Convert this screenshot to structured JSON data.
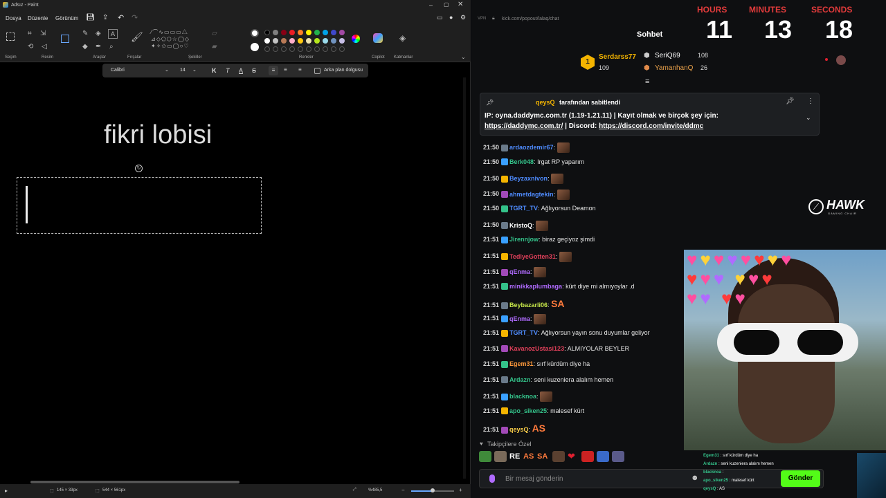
{
  "paint": {
    "title": "Adsız - Paint",
    "menu": [
      "Dosya",
      "Düzenle",
      "Görünüm"
    ],
    "groups": {
      "selection": "Seçim",
      "image": "Resim",
      "tools": "Araçlar",
      "brushes": "Fırçalar",
      "shapes": "Şekiller",
      "colors": "Renkler",
      "copilot": "Copilot",
      "layers": "Katmanlar"
    },
    "text_toolbar": {
      "font": "Calibri",
      "size": "14",
      "bold": "K",
      "italic": "T",
      "fill_label": "Arka plan dolgusu"
    },
    "canvas_text": "fikri lobisi",
    "status": {
      "selection_size": "145 × 33px",
      "canvas_size": "544 × 561px",
      "zoom": "%485,5"
    },
    "colors": [
      "#000000",
      "#7f7f7f",
      "#880015",
      "#ed1c24",
      "#ff7f27",
      "#fff200",
      "#22b14c",
      "#00a2e8",
      "#3f48cc",
      "#a349a4",
      "#ffffff",
      "#c3c3c3",
      "#b97a57",
      "#ffaec9",
      "#ffc90e",
      "#efe4b0",
      "#b5e61d",
      "#99d9ea",
      "#7092be",
      "#c8bfe7"
    ]
  },
  "browser": {
    "url": "kick.com/popout/lalaq/chat"
  },
  "chat": {
    "header": "Sohbet",
    "leaders": [
      {
        "rank": "1",
        "name": "Serdarss77",
        "count": "109"
      },
      {
        "name": "SeriQ69",
        "count": "108"
      },
      {
        "name": "YamanhanQ",
        "count": "26"
      }
    ],
    "pinned": {
      "user": "qeysQ",
      "suffix": "tarafından sabitlendi",
      "line1": "IP: oyna.daddymc.com.tr (1.19-1.21.11) | Kayıt olmak ve birçok şey için:",
      "link1": "https://daddymc.com.tr/",
      "sep": " | Discord: ",
      "link2": "https://discord.com/invite/ddmc"
    },
    "messages": [
      {
        "time": "21:50",
        "user": "ardaozdemir67",
        "color": "#4f8cff",
        "text": ""
      },
      {
        "time": "21:50",
        "user": "Berk048",
        "color": "#34c28a",
        "text": "Irgat RP yaparım"
      },
      {
        "time": "21:50",
        "user": "Beyzaxnivon",
        "color": "#4f8cff",
        "text": ""
      },
      {
        "time": "21:50",
        "user": "ahmetdagtekin",
        "color": "#4f8cff",
        "text": ""
      },
      {
        "time": "21:50",
        "user": "TGRT_TV",
        "color": "#4f8cff",
        "text": "Ağlıyorsun Deamon"
      },
      {
        "time": "21:50",
        "user": "KristoQ",
        "color": "#ffffff",
        "text": ""
      },
      {
        "time": "21:51",
        "user": "Jirennjow",
        "color": "#34c28a",
        "text": "biraz geçiyoz şimdi"
      },
      {
        "time": "21:51",
        "user": "TedlyeGotten31",
        "color": "#e0405a",
        "text": ""
      },
      {
        "time": "21:51",
        "user": "qEnma",
        "color": "#b06bff",
        "text": ""
      },
      {
        "time": "21:51",
        "user": "minikkaplumbaga",
        "color": "#b06bff",
        "text": "kürt diye mi almıyoylar .d"
      },
      {
        "time": "21:51",
        "user": "Beybazarli06",
        "color": "#c8e84a",
        "text": "SA"
      },
      {
        "time": "21:51",
        "user": "qEnma",
        "color": "#b06bff",
        "text": ""
      },
      {
        "time": "21:51",
        "user": "TGRT_TV",
        "color": "#4f8cff",
        "text": "Ağlıyorsun yayın sonu duyumlar geliyor"
      },
      {
        "time": "21:51",
        "user": "KavanozUstasi123",
        "color": "#e0405a",
        "text": "ALMIYOLAR BEYLER"
      },
      {
        "time": "21:51",
        "user": "Egem31",
        "color": "#ff9a3c",
        "text": "sırf kürdüm diye ha"
      },
      {
        "time": "21:51",
        "user": "Ardazn",
        "color": "#34c28a",
        "text": "seni kuzeniera alalım hemen"
      },
      {
        "time": "21:51",
        "user": "blacknoa",
        "color": "#34c28a",
        "text": ""
      },
      {
        "time": "21:51",
        "user": "apo_siken25",
        "color": "#34c28a",
        "text": "malesef kürt"
      },
      {
        "time": "21:51",
        "user": "qeysQ",
        "color": "#ffd24a",
        "text": "AS"
      }
    ],
    "followers_only": "Takipçilere Özel",
    "emote_row": [
      "RE",
      "AS",
      "SA"
    ],
    "input_placeholder": "Bir mesaj gönderin",
    "send": "Gönder"
  },
  "timer": {
    "hours_label": "HOURS",
    "minutes_label": "MINUTES",
    "seconds_label": "SECONDS",
    "hours": "11",
    "minutes": "13",
    "seconds": "18"
  },
  "sponsor": {
    "name": "HAWK",
    "sub": "GAMING CHAIR"
  },
  "overlay_chat": [
    {
      "user": "Egem31",
      "text": "sırf kürdüm diye ha"
    },
    {
      "user": "Ardazn",
      "text": "seni kuzeniera alalım hemen"
    },
    {
      "user": "blacknoa",
      "text": ""
    },
    {
      "user": "apo_siken25",
      "text": "malesef kürt"
    },
    {
      "user": "qeysQ",
      "text": "AS"
    }
  ]
}
